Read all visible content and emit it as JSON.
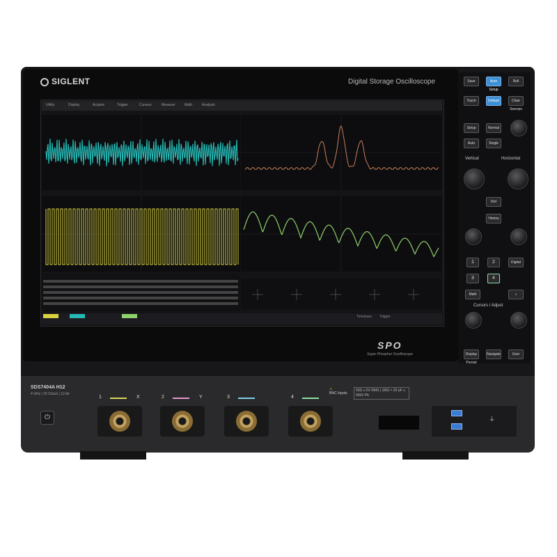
{
  "brand": "SIGLENT",
  "device_title": "Digital Storage Oscilloscope",
  "menu": [
    "Utility",
    "Display",
    "Acquire",
    "Trigger",
    "Cursors",
    "Measure",
    "Math",
    "Analysis"
  ],
  "panel_keys": {
    "save": "Save",
    "auto_setup": "Auto Setup",
    "roll": "Roll",
    "touch": "Touch",
    "default": "Default",
    "clear_sweeps": "Clear Sweeps",
    "setup": "Setup",
    "normal": "Normal",
    "auto": "Auto",
    "single": "Single",
    "ref": "Ref",
    "history": "History",
    "digital": "Digital",
    "math": "Math",
    "display_persist": "Display Persist",
    "navigate": "Navigate",
    "user": "User"
  },
  "panel_labels": {
    "vertical": "Vertical",
    "horizontal": "Horizontal",
    "cursors_adjust": "Cursors / Adjust"
  },
  "number_keys": [
    "1",
    "2",
    "3",
    "4"
  ],
  "screen_status": {
    "timebase": "Timebase",
    "trigger": "Trigger"
  },
  "spo_logo": "SPO",
  "spo_tagline": "Super Phosphor Oscilloscope",
  "model": "SDS7404A H12",
  "model_sub": "4 GHz | 20 GSa/s | 12-bit",
  "channels": [
    {
      "num": "1",
      "suffix": "X",
      "color": "#d8d85a"
    },
    {
      "num": "2",
      "suffix": "Y",
      "color": "#e59ad6"
    },
    {
      "num": "3",
      "suffix": "",
      "color": "#7fd0e8"
    },
    {
      "num": "4",
      "suffix": "",
      "color": "#8fe0a8"
    }
  ],
  "bnc_label": "BNC Inputs",
  "bnc_spec": "50Ω ≤ 5V RMS | 1MΩ = 20 pF ≤ 400V Pk"
}
